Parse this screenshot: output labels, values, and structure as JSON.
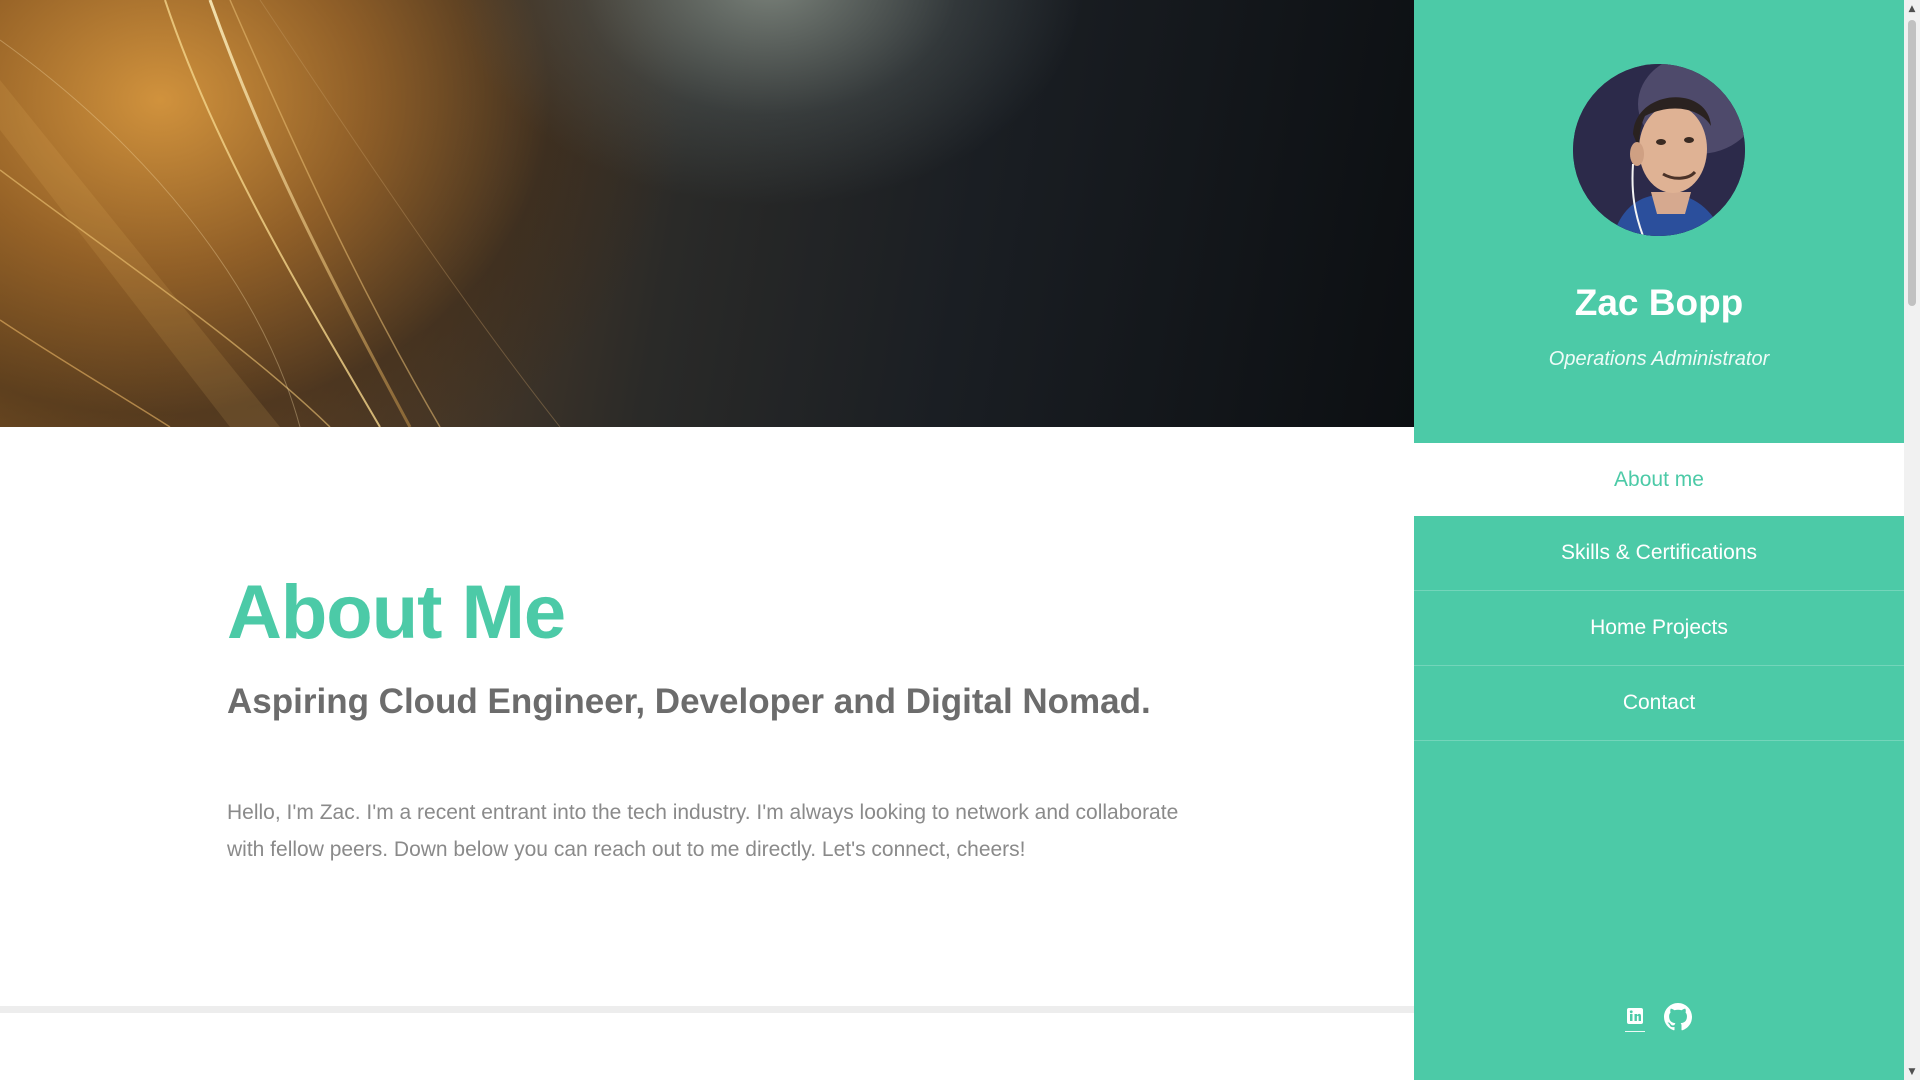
{
  "profile": {
    "name": "Zac Bopp",
    "role": "Operations Administrator"
  },
  "nav": {
    "items": [
      {
        "label": "About me",
        "active": true
      },
      {
        "label": "Skills & Certifications",
        "active": false
      },
      {
        "label": "Home Projects",
        "active": false
      },
      {
        "label": "Contact",
        "active": false
      }
    ]
  },
  "about": {
    "title": "About Me",
    "subtitle": "Aspiring Cloud Engineer, Developer and Digital Nomad.",
    "text": "Hello, I'm Zac. I'm a recent entrant into the tech industry. I'm always looking to network and collaborate with fellow peers. Down below you can reach out to me directly. Let's connect, cheers!"
  },
  "social": [
    {
      "icon": "linkedin-icon"
    },
    {
      "icon": "github-icon"
    }
  ],
  "colors": {
    "accent": "#4ccaa7",
    "heading_gray": "#6c6c6c",
    "body_gray": "#8a8a8a"
  }
}
